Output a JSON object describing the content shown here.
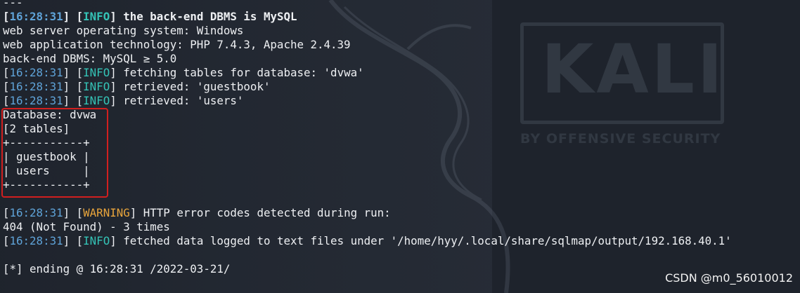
{
  "theme": {
    "bg": "#1e232c",
    "timestamp_color": "#5fa3d8",
    "info_color": "#34c3b6",
    "warning_color": "#e8a53c",
    "box_color": "#d11f1f"
  },
  "background": {
    "logo_text": "KALI",
    "logo_subtitle": "BY OFFENSIVE SECURITY"
  },
  "terminal": {
    "lines": [
      {
        "plain": "---"
      },
      {
        "ts": "16:28:31",
        "level": "INFO",
        "level_type": "info",
        "text": "the back-end DBMS is MySQL",
        "bold": true
      },
      {
        "plain": "web server operating system: Windows"
      },
      {
        "plain": "web application technology: PHP 7.4.3, Apache 2.4.39"
      },
      {
        "plain": "back-end DBMS: MySQL ≥ 5.0"
      },
      {
        "ts": "16:28:31",
        "level": "INFO",
        "level_type": "info",
        "text": "fetching tables for database: 'dvwa'"
      },
      {
        "ts": "16:28:31",
        "level": "INFO",
        "level_type": "info",
        "text": "retrieved: 'guestbook'"
      },
      {
        "ts": "16:28:31",
        "level": "INFO",
        "level_type": "info",
        "text": "retrieved: 'users'"
      },
      {
        "plain": "Database: dvwa"
      },
      {
        "plain": "[2 tables]"
      },
      {
        "plain": "+-----------+"
      },
      {
        "plain": "| guestbook |"
      },
      {
        "plain": "| users     |"
      },
      {
        "plain": "+-----------+"
      },
      {
        "plain": ""
      },
      {
        "ts": "16:28:31",
        "level": "WARNING",
        "level_type": "warn",
        "text": "HTTP error codes detected during run:"
      },
      {
        "plain": "404 (Not Found) - 3 times"
      },
      {
        "ts": "16:28:31",
        "level": "INFO",
        "level_type": "info",
        "text": "fetched data logged to text files under '/home/hyy/.local/share/sqlmap/output/192.168.40.1'"
      },
      {
        "plain": ""
      },
      {
        "plain": "[*] ending @ 16:28:31 /2022-03-21/"
      }
    ]
  },
  "watermark": "CSDN @m0_56010012"
}
